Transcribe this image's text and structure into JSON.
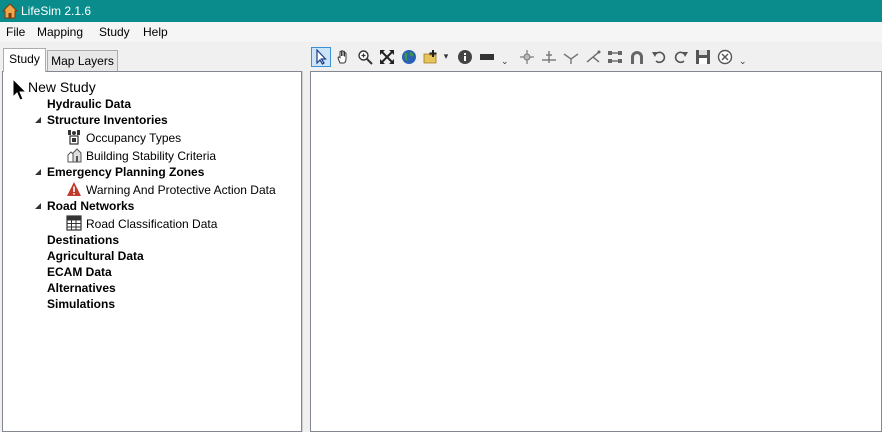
{
  "window": {
    "title": "LifeSim 2.1.6"
  },
  "menu": [
    "File",
    "Mapping",
    "Study",
    "Help"
  ],
  "tabs": [
    "Study",
    "Map Layers"
  ],
  "tree": {
    "root": "New Study",
    "hydraulic": "Hydraulic Data",
    "structure": "Structure Inventories",
    "occupancy": "Occupancy Types",
    "stability": "Building Stability Criteria",
    "emergency": "Emergency Planning Zones",
    "warning": "Warning And Protective Action Data",
    "road": "Road Networks",
    "roadclass": "Road Classification Data",
    "destinations": "Destinations",
    "agricultural": "Agricultural Data",
    "ecam": "ECAM Data",
    "alternatives": "Alternatives",
    "simulations": "Simulations"
  },
  "toolbar_icons": [
    "select-pointer-icon",
    "pan-hand-icon",
    "zoom-in-icon",
    "full-extent-icon",
    "globe-icon",
    "add-layer-icon",
    "identify-icon",
    "measure-icon",
    "move-vertex-icon",
    "split-icon",
    "merge-icon",
    "branch-icon",
    "connect-icon",
    "arch-icon",
    "undo-icon",
    "redo-icon",
    "save-icon",
    "cancel-icon"
  ],
  "colors": {
    "titlebar": "#0b8c8c",
    "selection": "#cce4f7",
    "warning": "#c0392b"
  }
}
